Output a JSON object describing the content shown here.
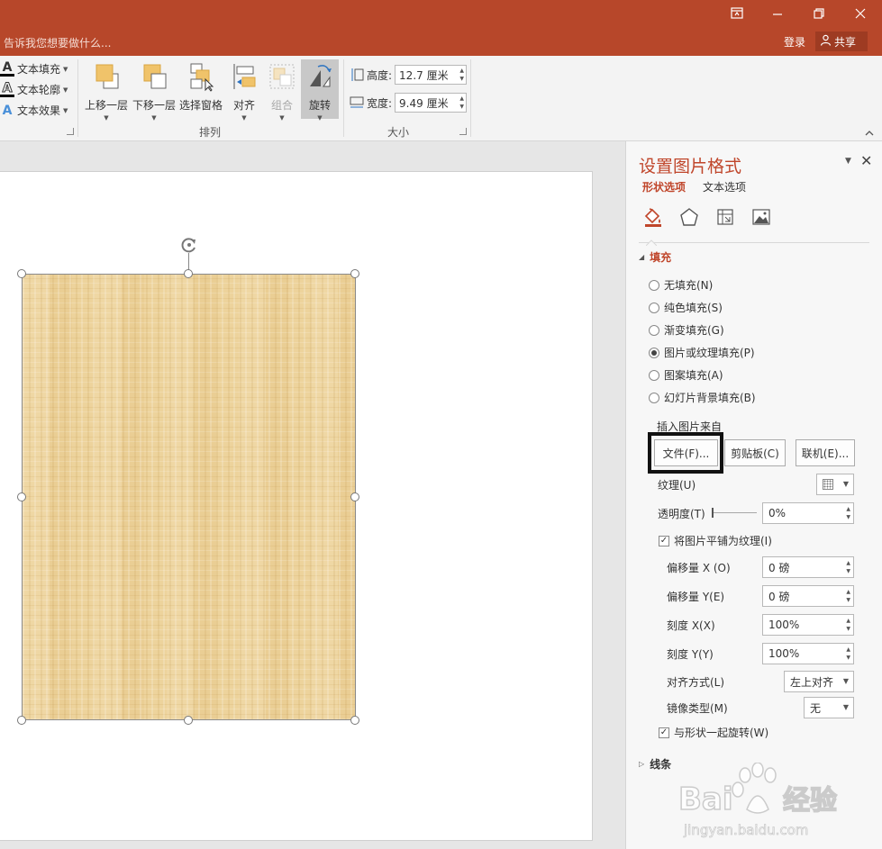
{
  "titlebar": {
    "tell_me": "告诉我您想要做什么...",
    "login": "登录",
    "share": "共享"
  },
  "ribbon": {
    "text_fill": "文本填充",
    "text_outline": "文本轮廓",
    "text_effect": "文本效果",
    "bring_forward": "上移一层",
    "send_backward": "下移一层",
    "selection_pane": "选择窗格",
    "align": "对齐",
    "group": "组合",
    "rotate": "旋转",
    "arrange_group": "排列",
    "size_group": "大小",
    "height_label": "高度:",
    "height_value": "12.7 厘米",
    "width_label": "宽度:",
    "width_value": "9.49 厘米"
  },
  "pane": {
    "title": "设置图片格式",
    "tab_shape": "形状选项",
    "tab_text": "文本选项",
    "fill_header": "填充",
    "fill_options": [
      {
        "label": "无填充(N)",
        "selected": false
      },
      {
        "label": "纯色填充(S)",
        "selected": false
      },
      {
        "label": "渐变填充(G)",
        "selected": false
      },
      {
        "label": "图片或纹理填充(P)",
        "selected": true
      },
      {
        "label": "图案填充(A)",
        "selected": false
      },
      {
        "label": "幻灯片背景填充(B)",
        "selected": false
      }
    ],
    "insert_from": "插入图片来自",
    "btn_file": "文件(F)...",
    "btn_clipboard": "剪贴板(C)",
    "btn_online": "联机(E)...",
    "texture_label": "纹理(U)",
    "transparency_label": "透明度(T)",
    "transparency_value": "0%",
    "tile_label": "将图片平铺为纹理(I)",
    "tile_checked": true,
    "offset_x_label": "偏移量 X (O)",
    "offset_x_value": "0 磅",
    "offset_y_label": "偏移量 Y(E)",
    "offset_y_value": "0 磅",
    "scale_x_label": "刻度 X(X)",
    "scale_x_value": "100%",
    "scale_y_label": "刻度 Y(Y)",
    "scale_y_value": "100%",
    "alignment_label": "对齐方式(L)",
    "alignment_value": "左上对齐",
    "mirror_label": "镜像类型(M)",
    "mirror_value": "无",
    "rotate_with_shape_label": "与形状一起旋转(W)",
    "rotate_with_shape_checked": true,
    "line_header": "线条"
  },
  "watermark": {
    "brand": "Bai",
    "brand_suffix": "经验",
    "url": "jingyan.baidu.com"
  },
  "colors": {
    "accent": "#b7472a",
    "pane_accent": "#c0462b",
    "texture_base": "#edd39c"
  }
}
